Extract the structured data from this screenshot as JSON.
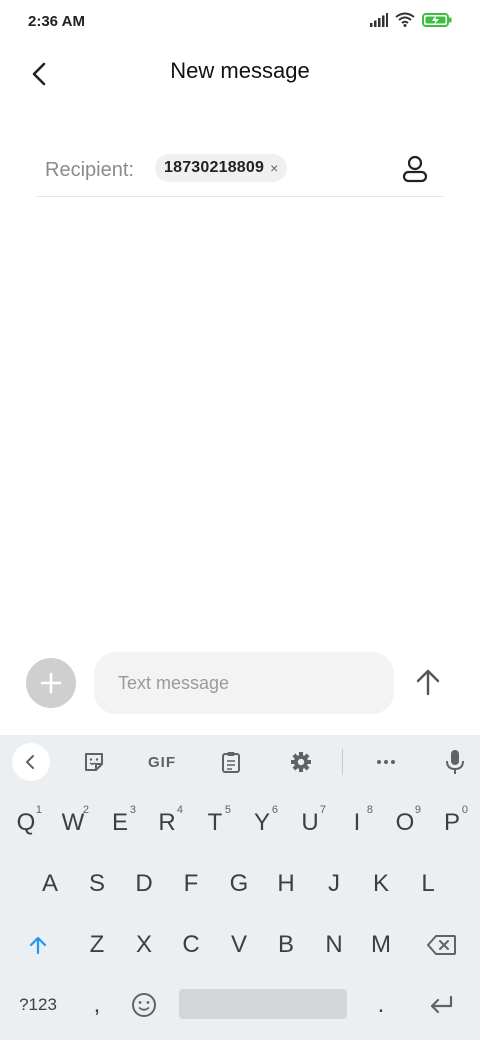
{
  "status": {
    "time": "2:36 AM",
    "icons": [
      "signal-icon",
      "wifi-icon",
      "battery-charging-icon"
    ],
    "battery_color": "#3fbf3f"
  },
  "header": {
    "title": "New message"
  },
  "recipient": {
    "label": "Recipient:",
    "chip": "18730218809",
    "chip_remove": "×"
  },
  "compose": {
    "placeholder": "Text message"
  },
  "keyboard": {
    "toolbar": {
      "gif": "GIF"
    },
    "row1": [
      {
        "k": "Q",
        "h": "1"
      },
      {
        "k": "W",
        "h": "2"
      },
      {
        "k": "E",
        "h": "3"
      },
      {
        "k": "R",
        "h": "4"
      },
      {
        "k": "T",
        "h": "5"
      },
      {
        "k": "Y",
        "h": "6"
      },
      {
        "k": "U",
        "h": "7"
      },
      {
        "k": "I",
        "h": "8"
      },
      {
        "k": "O",
        "h": "9"
      },
      {
        "k": "P",
        "h": "0"
      }
    ],
    "row2": [
      "A",
      "S",
      "D",
      "F",
      "G",
      "H",
      "J",
      "K",
      "L"
    ],
    "row3": [
      "Z",
      "X",
      "C",
      "V",
      "B",
      "N",
      "M"
    ],
    "row4": {
      "symbols": "?123",
      "comma": ",",
      "period": "."
    }
  },
  "colors": {
    "accent": "#1a73e8",
    "shift": "#2196f3",
    "key_text": "#3c4043",
    "keyboard_bg": "#eceff1"
  }
}
